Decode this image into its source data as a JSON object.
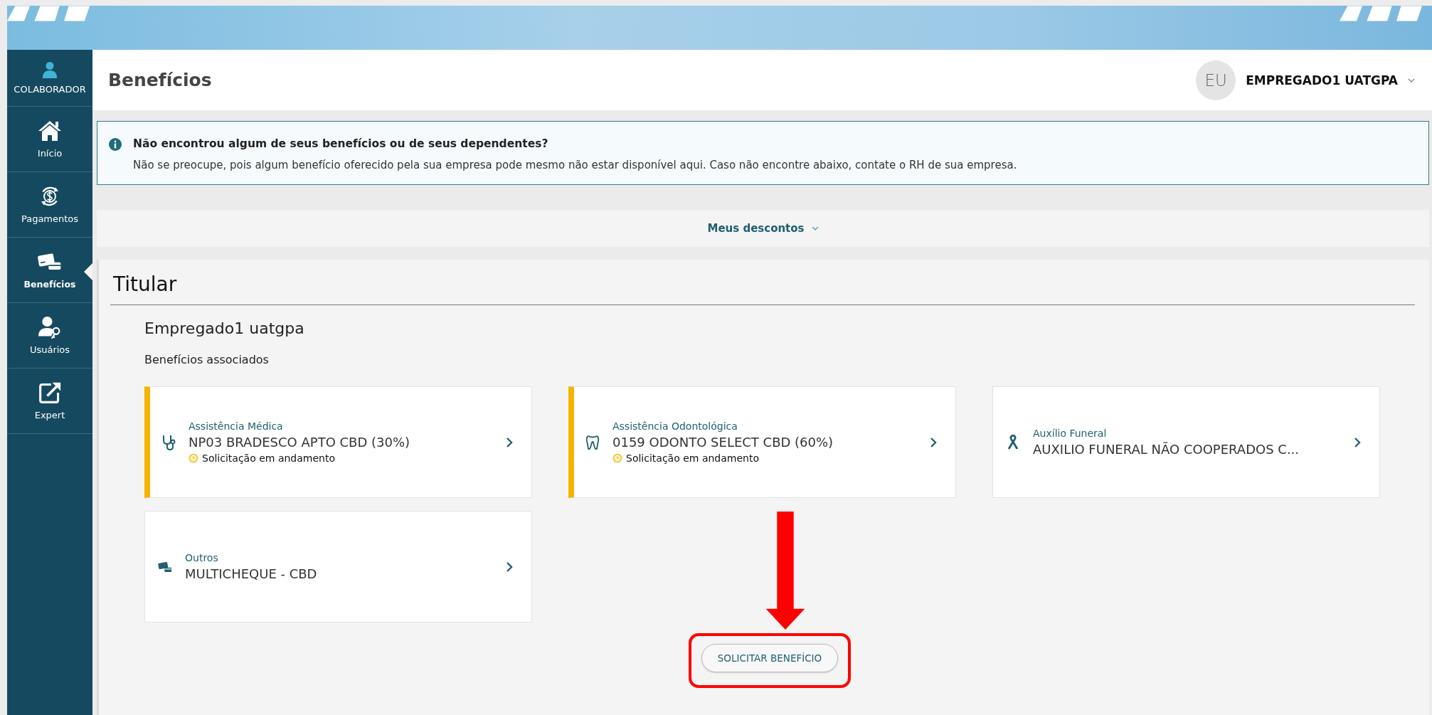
{
  "sidebar": {
    "items": [
      {
        "kind": "user",
        "label": "COLABORADOR",
        "selected": false
      },
      {
        "kind": "home",
        "label": "Início",
        "selected": false
      },
      {
        "kind": "payments",
        "label": "Pagamentos",
        "selected": false
      },
      {
        "kind": "benefits",
        "label": "Benefícios",
        "selected": true
      },
      {
        "kind": "users",
        "label": "Usuários",
        "selected": false
      },
      {
        "kind": "external",
        "label": "Expert",
        "selected": false
      }
    ]
  },
  "header": {
    "title": "Benefícios",
    "avatar_initials": "EU",
    "user_name": "EMPREGADO1 UATGPA"
  },
  "notice": {
    "title": "Não encontrou algum de seus benefícios ou de seus dependentes?",
    "text": "Não se preocupe, pois algum benefício oferecido pela sua empresa pode mesmo não estar disponível aqui. Caso não encontre abaixo, contate o RH de sua empresa."
  },
  "discounts_toggle": {
    "label": "Meus descontos",
    "expanded": false
  },
  "section": {
    "title": "Titular",
    "person": "Empregado1 uatgpa",
    "subtitle": "Benefícios associados",
    "cards": [
      {
        "kind": "medical",
        "category": "Assistência Médica",
        "name": "NP03 BRADESCO APTO CBD (30%)",
        "pending": true,
        "status": "Solicitação em andamento"
      },
      {
        "kind": "dental",
        "category": "Assistência Odontológica",
        "name": "0159 ODONTO SELECT CBD (60%)",
        "pending": true,
        "status": "Solicitação em andamento"
      },
      {
        "kind": "funeral",
        "category": "Auxílio Funeral",
        "name": "AUXILIO FUNERAL NÃO COOPERADOS C...",
        "pending": false
      },
      {
        "kind": "other",
        "category": "Outros",
        "name": "MULTICHEQUE - CBD",
        "pending": false
      }
    ],
    "action_button": "SOLICITAR BENEFÍCIO"
  }
}
